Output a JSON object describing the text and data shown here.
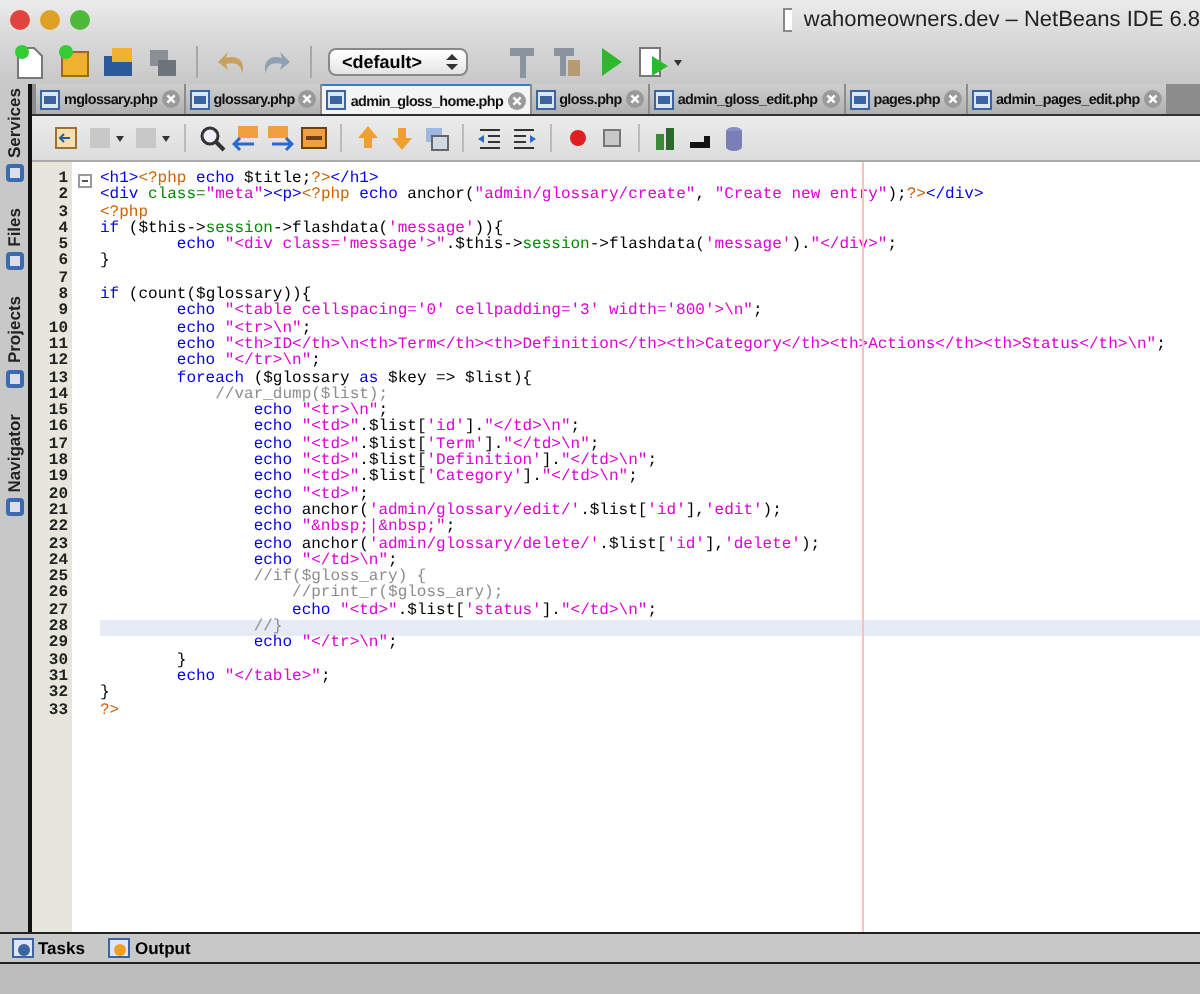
{
  "window": {
    "title": "wahomeowners.dev – NetBeans IDE 6.8"
  },
  "toolbar": {
    "configuration": "<default>"
  },
  "tabs": [
    {
      "label": "mglossary.php",
      "selected": false
    },
    {
      "label": "glossary.php",
      "selected": false
    },
    {
      "label": "admin_gloss_home.php",
      "selected": true
    },
    {
      "label": "gloss.php",
      "selected": false
    },
    {
      "label": "admin_gloss_edit.php",
      "selected": false
    },
    {
      "label": "pages.php",
      "selected": false
    },
    {
      "label": "admin_pages_edit.php",
      "selected": false
    }
  ],
  "side_panels": [
    "Services",
    "Files",
    "Projects",
    "Navigator"
  ],
  "editor": {
    "lines": [
      {
        "number": "1",
        "current": false,
        "tokens": [
          {
            "kind": "kw",
            "text": "<h1>"
          },
          {
            "kind": "php",
            "text": "<?php"
          },
          {
            "kind": "kw",
            "text": " echo "
          },
          {
            "kind": "txt",
            "text": "$title;"
          },
          {
            "kind": "php",
            "text": "?>"
          },
          {
            "kind": "kw",
            "text": "</h1>"
          }
        ]
      },
      {
        "number": "2",
        "current": false,
        "tokens": [
          {
            "kind": "kw",
            "text": "<div "
          },
          {
            "kind": "fld",
            "text": "class="
          },
          {
            "kind": "str",
            "text": "\"meta\""
          },
          {
            "kind": "kw",
            "text": "><p>"
          },
          {
            "kind": "php",
            "text": "<?php"
          },
          {
            "kind": "kw",
            "text": " echo "
          },
          {
            "kind": "txt",
            "text": "anchor("
          },
          {
            "kind": "str",
            "text": "\"admin/glossary/create\""
          },
          {
            "kind": "txt",
            "text": ", "
          },
          {
            "kind": "str",
            "text": "\"Create new entry\""
          },
          {
            "kind": "txt",
            "text": ");"
          },
          {
            "kind": "php",
            "text": "?>"
          },
          {
            "kind": "kw",
            "text": "</div>"
          }
        ]
      },
      {
        "number": "3",
        "current": false,
        "tokens": [
          {
            "kind": "php",
            "text": "<?php"
          }
        ]
      },
      {
        "number": "4",
        "current": false,
        "tokens": [
          {
            "kind": "kw",
            "text": "if"
          },
          {
            "kind": "txt",
            "text": " ($this->"
          },
          {
            "kind": "fld",
            "text": "session"
          },
          {
            "kind": "txt",
            "text": "->flashdata("
          },
          {
            "kind": "str",
            "text": "'message'"
          },
          {
            "kind": "txt",
            "text": ")){"
          }
        ]
      },
      {
        "number": "5",
        "current": false,
        "tokens": [
          {
            "kind": "kw",
            "text": "        echo "
          },
          {
            "kind": "str",
            "text": "\"<div class='message'>\""
          },
          {
            "kind": "txt",
            "text": ".$this->"
          },
          {
            "kind": "fld",
            "text": "session"
          },
          {
            "kind": "txt",
            "text": "->flashdata("
          },
          {
            "kind": "str",
            "text": "'message'"
          },
          {
            "kind": "txt",
            "text": ")."
          },
          {
            "kind": "str",
            "text": "\"</div>\""
          },
          {
            "kind": "txt",
            "text": ";"
          }
        ]
      },
      {
        "number": "6",
        "current": false,
        "tokens": [
          {
            "kind": "txt",
            "text": "}"
          }
        ]
      },
      {
        "number": "7",
        "current": false
      },
      {
        "number": "8",
        "current": false,
        "tokens": [
          {
            "kind": "kw",
            "text": "if"
          },
          {
            "kind": "txt",
            "text": " (count($glossary)){"
          }
        ]
      },
      {
        "number": "9",
        "current": false,
        "tokens": [
          {
            "kind": "kw",
            "text": "        echo "
          },
          {
            "kind": "str",
            "text": "\"<table cellspacing='0' cellpadding='3' width='800'>\\n\""
          },
          {
            "kind": "txt",
            "text": ";"
          }
        ]
      },
      {
        "number": "10",
        "current": false,
        "tokens": [
          {
            "kind": "kw",
            "text": "        echo "
          },
          {
            "kind": "str",
            "text": "\"<tr>\\n\""
          },
          {
            "kind": "txt",
            "text": ";"
          }
        ]
      },
      {
        "number": "11",
        "current": false,
        "tokens": [
          {
            "kind": "kw",
            "text": "        echo "
          },
          {
            "kind": "str",
            "text": "\"<th>ID</th>\\n<th>Term</th><th>Definition</th><th>Category</th><th>Actions</th><th>Status</th>\\n\""
          },
          {
            "kind": "txt",
            "text": ";"
          }
        ]
      },
      {
        "number": "12",
        "current": false,
        "tokens": [
          {
            "kind": "kw",
            "text": "        echo "
          },
          {
            "kind": "str",
            "text": "\"</tr>\\n\""
          },
          {
            "kind": "txt",
            "text": ";"
          }
        ]
      },
      {
        "number": "13",
        "current": false,
        "tokens": [
          {
            "kind": "kw",
            "text": "        foreach"
          },
          {
            "kind": "txt",
            "text": " ($glossary "
          },
          {
            "kind": "kw",
            "text": "as"
          },
          {
            "kind": "txt",
            "text": " $key => $list){"
          }
        ]
      },
      {
        "number": "14",
        "current": false,
        "tokens": [
          {
            "kind": "cmt",
            "text": "            //var_dump($list);"
          }
        ]
      },
      {
        "number": "15",
        "current": false,
        "tokens": [
          {
            "kind": "kw",
            "text": "                echo "
          },
          {
            "kind": "str",
            "text": "\"<tr>\\n\""
          },
          {
            "kind": "txt",
            "text": ";"
          }
        ]
      },
      {
        "number": "16",
        "current": false,
        "tokens": [
          {
            "kind": "kw",
            "text": "                echo "
          },
          {
            "kind": "str",
            "text": "\"<td>\""
          },
          {
            "kind": "txt",
            "text": ".$list["
          },
          {
            "kind": "str",
            "text": "'id'"
          },
          {
            "kind": "txt",
            "text": "]."
          },
          {
            "kind": "str",
            "text": "\"</td>\\n\""
          },
          {
            "kind": "txt",
            "text": ";"
          }
        ]
      },
      {
        "number": "17",
        "current": false,
        "tokens": [
          {
            "kind": "kw",
            "text": "                echo "
          },
          {
            "kind": "str",
            "text": "\"<td>\""
          },
          {
            "kind": "txt",
            "text": ".$list["
          },
          {
            "kind": "str",
            "text": "'Term'"
          },
          {
            "kind": "txt",
            "text": "]."
          },
          {
            "kind": "str",
            "text": "\"</td>\\n\""
          },
          {
            "kind": "txt",
            "text": ";"
          }
        ]
      },
      {
        "number": "18",
        "current": false,
        "tokens": [
          {
            "kind": "kw",
            "text": "                echo "
          },
          {
            "kind": "str",
            "text": "\"<td>\""
          },
          {
            "kind": "txt",
            "text": ".$list["
          },
          {
            "kind": "str",
            "text": "'Definition'"
          },
          {
            "kind": "txt",
            "text": "]."
          },
          {
            "kind": "str",
            "text": "\"</td>\\n\""
          },
          {
            "kind": "txt",
            "text": ";"
          }
        ]
      },
      {
        "number": "19",
        "current": false,
        "tokens": [
          {
            "kind": "kw",
            "text": "                echo "
          },
          {
            "kind": "str",
            "text": "\"<td>\""
          },
          {
            "kind": "txt",
            "text": ".$list["
          },
          {
            "kind": "str",
            "text": "'Category'"
          },
          {
            "kind": "txt",
            "text": "]."
          },
          {
            "kind": "str",
            "text": "\"</td>\\n\""
          },
          {
            "kind": "txt",
            "text": ";"
          }
        ]
      },
      {
        "number": "20",
        "current": false,
        "tokens": [
          {
            "kind": "kw",
            "text": "                echo "
          },
          {
            "kind": "str",
            "text": "\"<td>\""
          },
          {
            "kind": "txt",
            "text": ";"
          }
        ]
      },
      {
        "number": "21",
        "current": false,
        "tokens": [
          {
            "kind": "kw",
            "text": "                echo "
          },
          {
            "kind": "txt",
            "text": "anchor("
          },
          {
            "kind": "str",
            "text": "'admin/glossary/edit/'"
          },
          {
            "kind": "txt",
            "text": ".$list["
          },
          {
            "kind": "str",
            "text": "'id'"
          },
          {
            "kind": "txt",
            "text": "],"
          },
          {
            "kind": "str",
            "text": "'edit'"
          },
          {
            "kind": "txt",
            "text": ");"
          }
        ]
      },
      {
        "number": "22",
        "current": false,
        "tokens": [
          {
            "kind": "kw",
            "text": "                echo "
          },
          {
            "kind": "str",
            "text": "\"&nbsp;|&nbsp;\""
          },
          {
            "kind": "txt",
            "text": ";"
          }
        ]
      },
      {
        "number": "23",
        "current": false,
        "tokens": [
          {
            "kind": "kw",
            "text": "                echo "
          },
          {
            "kind": "txt",
            "text": "anchor("
          },
          {
            "kind": "str",
            "text": "'admin/glossary/delete/'"
          },
          {
            "kind": "txt",
            "text": ".$list["
          },
          {
            "kind": "str",
            "text": "'id'"
          },
          {
            "kind": "txt",
            "text": "],"
          },
          {
            "kind": "str",
            "text": "'delete'"
          },
          {
            "kind": "txt",
            "text": ");"
          }
        ]
      },
      {
        "number": "24",
        "current": false,
        "tokens": [
          {
            "kind": "kw",
            "text": "                echo "
          },
          {
            "kind": "str",
            "text": "\"</td>\\n\""
          },
          {
            "kind": "txt",
            "text": ";"
          }
        ]
      },
      {
        "number": "25",
        "current": false,
        "tokens": [
          {
            "kind": "cmt",
            "text": "                //if($gloss_ary) {"
          }
        ]
      },
      {
        "number": "26",
        "current": false,
        "tokens": [
          {
            "kind": "cmt",
            "text": "                    //print_r($gloss_ary);"
          }
        ]
      },
      {
        "number": "27",
        "current": false,
        "tokens": [
          {
            "kind": "kw",
            "text": "                    echo "
          },
          {
            "kind": "str",
            "text": "\"<td>\""
          },
          {
            "kind": "txt",
            "text": ".$list["
          },
          {
            "kind": "str",
            "text": "'status'"
          },
          {
            "kind": "txt",
            "text": "]."
          },
          {
            "kind": "str",
            "text": "\"</td>\\n\""
          },
          {
            "kind": "txt",
            "text": ";"
          }
        ]
      },
      {
        "number": "28",
        "current": true,
        "tokens": [
          {
            "kind": "cmt",
            "text": "                //}"
          }
        ]
      },
      {
        "number": "29",
        "current": false,
        "tokens": [
          {
            "kind": "kw",
            "text": "                echo "
          },
          {
            "kind": "str",
            "text": "\"</tr>\\n\""
          },
          {
            "kind": "txt",
            "text": ";"
          }
        ]
      },
      {
        "number": "30",
        "current": false,
        "tokens": [
          {
            "kind": "txt",
            "text": "        }"
          }
        ]
      },
      {
        "number": "31",
        "current": false,
        "tokens": [
          {
            "kind": "kw",
            "text": "        echo "
          },
          {
            "kind": "str",
            "text": "\"</table>\""
          },
          {
            "kind": "txt",
            "text": ";"
          }
        ]
      },
      {
        "number": "32",
        "current": false,
        "tokens": [
          {
            "kind": "txt",
            "text": "}"
          }
        ]
      },
      {
        "number": "33",
        "current": false,
        "tokens": [
          {
            "kind": "php",
            "text": "?>"
          }
        ]
      }
    ]
  },
  "bottom_panels": [
    "Tasks",
    "Output"
  ]
}
